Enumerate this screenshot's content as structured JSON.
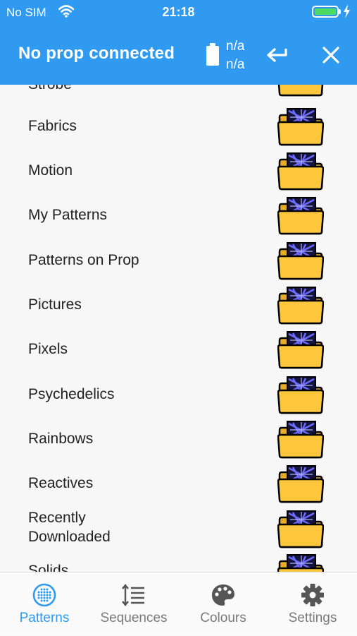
{
  "status_bar": {
    "carrier": "No SIM",
    "time": "21:18"
  },
  "app_bar": {
    "title": "No prop connected",
    "prop_value_1": "n/a",
    "prop_value_2": "n/a"
  },
  "list": {
    "partial_top_label": "Strobe",
    "items": [
      {
        "label": "Fabrics"
      },
      {
        "label": "Motion"
      },
      {
        "label": "My Patterns"
      },
      {
        "label": "Patterns on Prop"
      },
      {
        "label": "Pictures"
      },
      {
        "label": "Pixels"
      },
      {
        "label": "Psychedelics"
      },
      {
        "label": "Rainbows"
      },
      {
        "label": "Reactives"
      },
      {
        "label_line1": "Recently",
        "label_line2": "Downloaded"
      },
      {
        "label": "Solids"
      }
    ]
  },
  "bottom_nav": {
    "tabs": [
      {
        "label": "Patterns",
        "icon": "patterns-grid-icon",
        "active": true
      },
      {
        "label": "Sequences",
        "icon": "sequences-list-icon",
        "active": false
      },
      {
        "label": "Colours",
        "icon": "palette-icon",
        "active": false
      },
      {
        "label": "Settings",
        "icon": "gear-icon",
        "active": false
      }
    ]
  },
  "colors": {
    "accent": "#2f9af0",
    "folder": "#fcc73d",
    "folder_screen": "#1a1a4a",
    "inactive": "#7a7a7a"
  }
}
